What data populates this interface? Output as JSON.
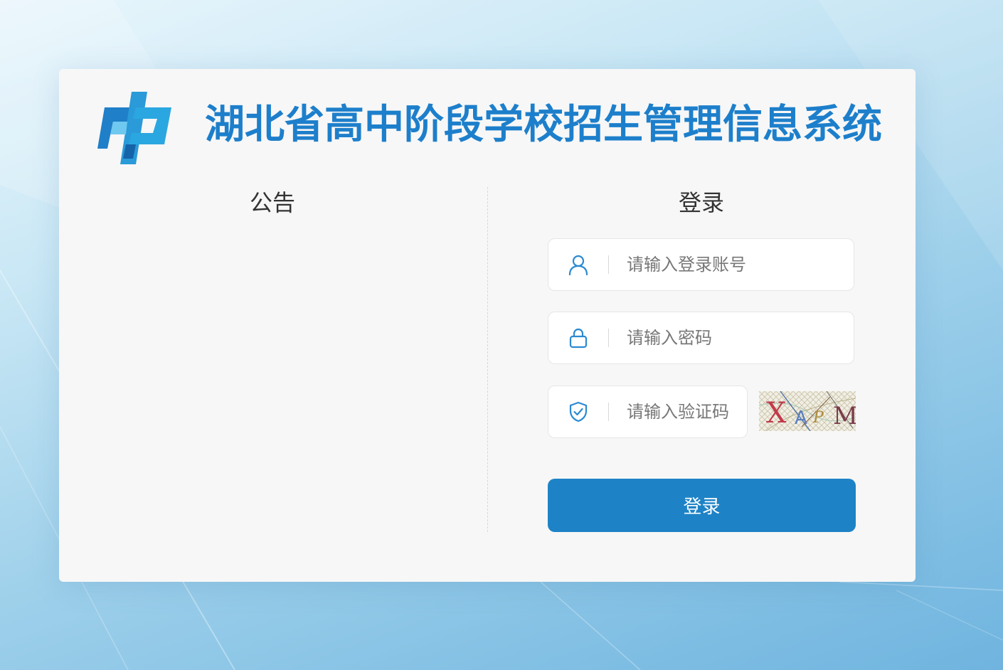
{
  "header": {
    "title": "湖北省高中阶段学校招生管理信息系统",
    "logo_icon": "zhong-logo-icon"
  },
  "notice": {
    "heading": "公告"
  },
  "login": {
    "heading": "登录",
    "username": {
      "icon": "user-icon",
      "value": "",
      "placeholder": "请输入登录账号"
    },
    "password": {
      "icon": "lock-icon",
      "value": "",
      "placeholder": "请输入密码"
    },
    "captcha": {
      "icon": "shield-check-icon",
      "value": "",
      "placeholder": "请输入验证码",
      "image_text": "XAPM"
    },
    "submit_label": "登录"
  },
  "colors": {
    "brand": "#1d7fcb",
    "button": "#1e83c6",
    "card_bg": "#f7f7f7",
    "heading_text": "#333333"
  }
}
